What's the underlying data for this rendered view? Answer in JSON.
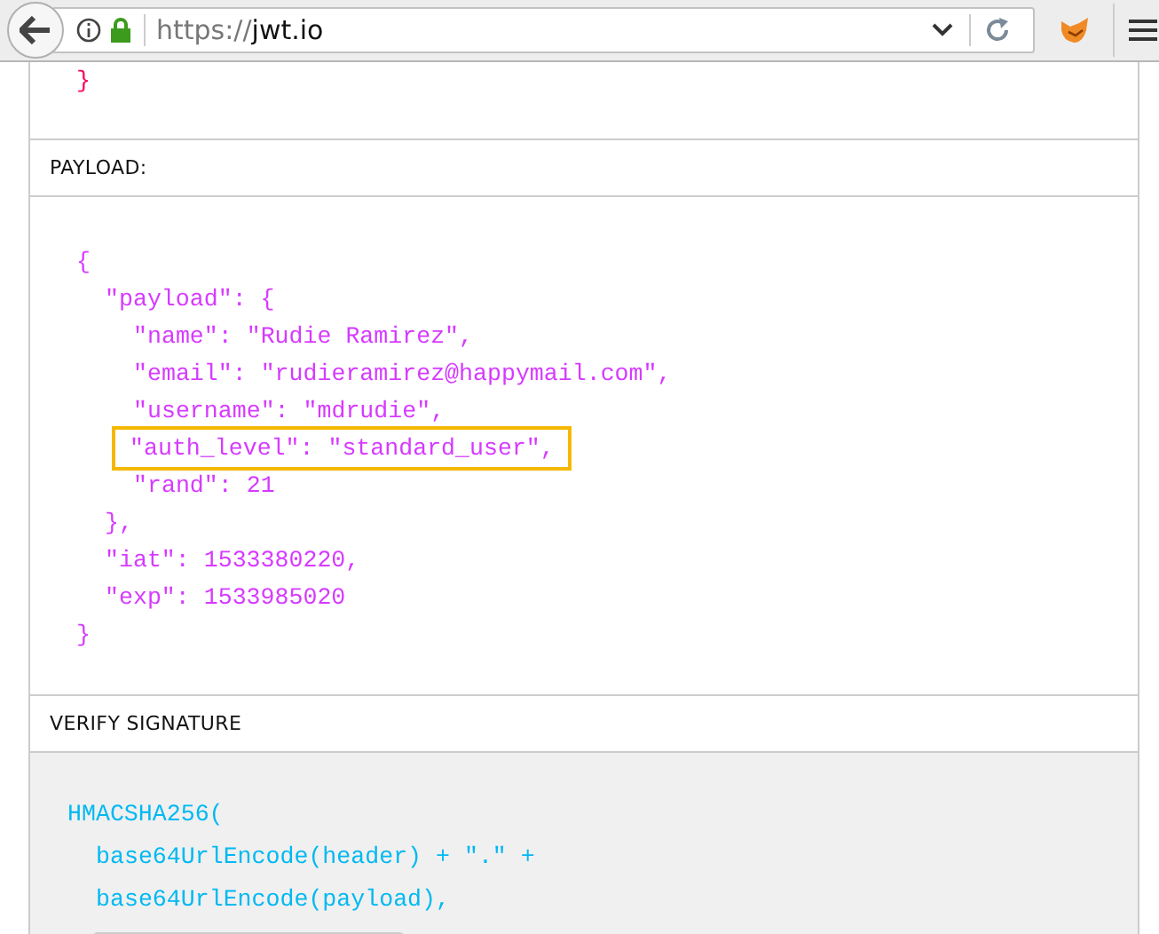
{
  "browser": {
    "url": {
      "scheme": "https://",
      "host": "jwt.io"
    }
  },
  "header": {
    "lines": [
      {
        "text": "}"
      }
    ]
  },
  "payload": {
    "title": "PAYLOAD:",
    "lines": [
      {
        "text": "{",
        "children": [
          {
            "text": "\"payload\": {",
            "children": [
              {
                "text": "\"name\": \"Rudie Ramirez\",",
                "highlighted": false
              },
              {
                "text": "\"email\": \"rudieramirez@happymail.com\",",
                "highlighted": false
              },
              {
                "text": "\"username\": \"mdrudie\",",
                "highlighted": false
              },
              {
                "text": "\"auth_level\": \"standard_user\",",
                "highlighted": true
              },
              {
                "text": "\"rand\": 21",
                "highlighted": false
              }
            ]
          },
          {
            "text": "},"
          },
          {
            "text": "\"iat\": 1533380220,"
          },
          {
            "text": "\"exp\": 1533985020"
          }
        ]
      },
      {
        "text": "}"
      }
    ]
  },
  "signature": {
    "title": "VERIFY SIGNATURE",
    "lines": [
      {
        "text": "HMACSHA256(",
        "children": [
          {
            "text": "base64UrlEncode(header) + \".\" +"
          },
          {
            "text": "base64UrlEncode(payload),"
          }
        ]
      }
    ]
  }
}
